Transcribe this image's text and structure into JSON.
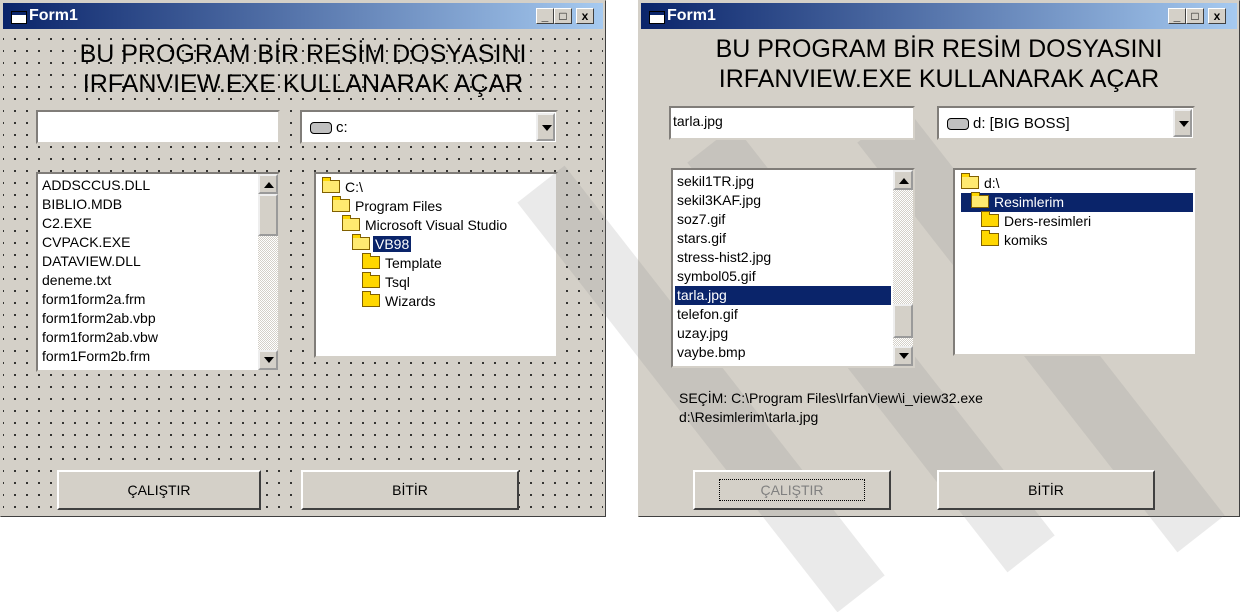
{
  "windows": [
    {
      "title": "Form1",
      "heading_line1": "BU PROGRAM BİR RESİM DOSYASINI",
      "heading_line2": "IRFANVIEW.EXE KULLANARAK AÇAR",
      "textbox_value": "",
      "drive_value": "c:",
      "files": [
        "ADDSCCUS.DLL",
        "BIBLIO.MDB",
        "C2.EXE",
        "CVPACK.EXE",
        "DATAVIEW.DLL",
        "deneme.txt",
        "form1form2a.frm",
        "form1form2ab.vbp",
        "form1form2ab.vbw",
        "form1Form2b.frm"
      ],
      "selected_file": null,
      "folders": [
        {
          "label": "C:\\",
          "level": 0,
          "open": true
        },
        {
          "label": "Program Files",
          "level": 1,
          "open": true
        },
        {
          "label": "Microsoft Visual Studio",
          "level": 2,
          "open": true
        },
        {
          "label": "VB98",
          "level": 3,
          "open": true,
          "selected": true
        },
        {
          "label": "Template",
          "level": 4,
          "open": false
        },
        {
          "label": "Tsql",
          "level": 4,
          "open": false
        },
        {
          "label": "Wizards",
          "level": 4,
          "open": false
        }
      ],
      "run_button": "ÇALIŞTIR",
      "exit_button": "BİTİR"
    },
    {
      "title": "Form1",
      "heading_line1": "BU PROGRAM BİR RESİM DOSYASINI",
      "heading_line2": "IRFANVIEW.EXE KULLANARAK AÇAR",
      "textbox_value": "tarla.jpg",
      "drive_value": "d: [BIG BOSS]",
      "files": [
        "sekil1TR.jpg",
        "sekil3KAF.jpg",
        "soz7.gif",
        "stars.gif",
        "stress-hist2.jpg",
        "symbol05.gif",
        "tarla.jpg",
        "telefon.gif",
        "uzay.jpg",
        "vaybe.bmp"
      ],
      "selected_file": 6,
      "folders": [
        {
          "label": "d:\\",
          "level": 0,
          "open": true
        },
        {
          "label": "Resimlerim",
          "level": 1,
          "open": true,
          "selected": true
        },
        {
          "label": "Ders-resimleri",
          "level": 2,
          "open": false
        },
        {
          "label": "komiks",
          "level": 2,
          "open": false
        }
      ],
      "selection_line1": "SEÇİM: C:\\Program Files\\IrfanView\\i_view32.exe",
      "selection_line2": "d:\\Resimlerim\\tarla.jpg",
      "run_button": "ÇALIŞTIR",
      "exit_button": "BİTİR"
    }
  ],
  "titlebar_controls": {
    "minimize": "_",
    "maximize": "□",
    "close": "x"
  }
}
